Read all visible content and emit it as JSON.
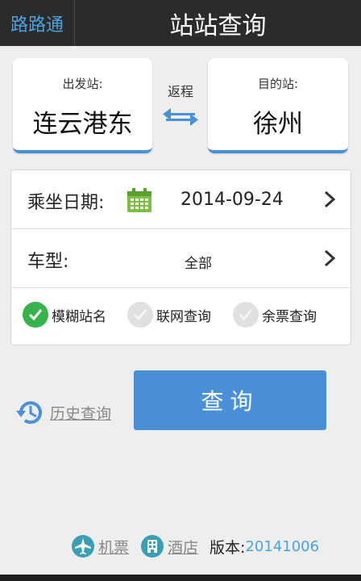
{
  "header": {
    "brand": "路路通",
    "title": "站站查询"
  },
  "from": {
    "label": "出发站:",
    "station": "连云港东"
  },
  "swap": {
    "label": "返程"
  },
  "to": {
    "label": "目的站:",
    "station": "徐州"
  },
  "date": {
    "label": "乘坐日期:",
    "value": "2014-09-24"
  },
  "train_type": {
    "label": "车型:",
    "value": "全部"
  },
  "options": [
    {
      "label": "模糊站名",
      "checked": true
    },
    {
      "label": "联网查询",
      "checked": false
    },
    {
      "label": "余票查询",
      "checked": false
    }
  ],
  "history": {
    "label": "历史查询"
  },
  "query_button": {
    "label": "查询"
  },
  "footer": {
    "flight_label": "机票",
    "hotel_label": "酒店",
    "version_label": "版本:",
    "version_value": "20141006"
  },
  "colors": {
    "accent": "#4a90d9",
    "check_on": "#36b34a",
    "header_bg": "#2b2b2b"
  }
}
